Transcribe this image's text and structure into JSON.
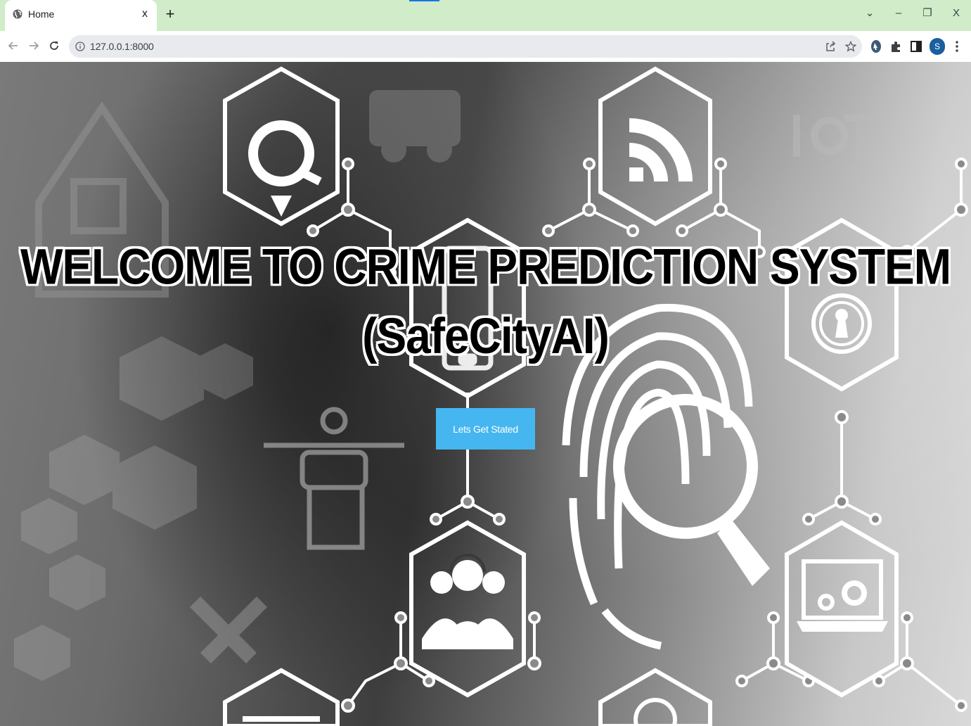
{
  "browser": {
    "tab": {
      "title": "Home",
      "close_label": "x",
      "favicon": "globe-icon"
    },
    "new_tab_label": "+",
    "window_controls": {
      "dropdown": "⌄",
      "minimize": "–",
      "restore": "❐",
      "close": "X"
    },
    "address": {
      "url": "127.0.0.1:8000",
      "info_icon": "info-icon"
    },
    "profile_initial": "S",
    "theme_colors": {
      "tabstrip": "#d0ecc8",
      "omnibox": "#e8eaed",
      "profile": "#1a5f9e"
    }
  },
  "hero": {
    "title_line1": "WELCOME TO CRIME PREDICTION SYSTEM",
    "title_line2": "(SafeCityAI)",
    "cta_label": "Lets Get Stated",
    "cta_color": "#45b6ef"
  }
}
